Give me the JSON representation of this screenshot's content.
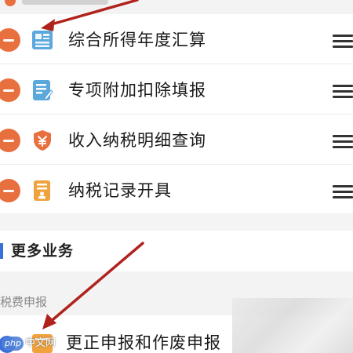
{
  "services": [
    {
      "label": "综合所得年度汇算",
      "icon": "annual-settlement-icon"
    },
    {
      "label": "专项附加扣除填报",
      "icon": "deduction-form-icon"
    },
    {
      "label": "收入纳税明细查询",
      "icon": "income-shield-icon"
    },
    {
      "label": "纳税记录开具",
      "icon": "tax-record-icon"
    }
  ],
  "more_section": {
    "title": "更多业务",
    "subtitle": "税费申报"
  },
  "last_item": {
    "label": "更正申报和作废申报",
    "icon": "correction-folder-icon"
  },
  "watermark": {
    "en": "php",
    "cn": "中文网"
  },
  "colors": {
    "remove": "#e8703f",
    "accent": "#3a6fd8",
    "arrow": "#b0231d",
    "icon_blue": "#5ba8dd",
    "icon_orange": "#f0a23c"
  }
}
